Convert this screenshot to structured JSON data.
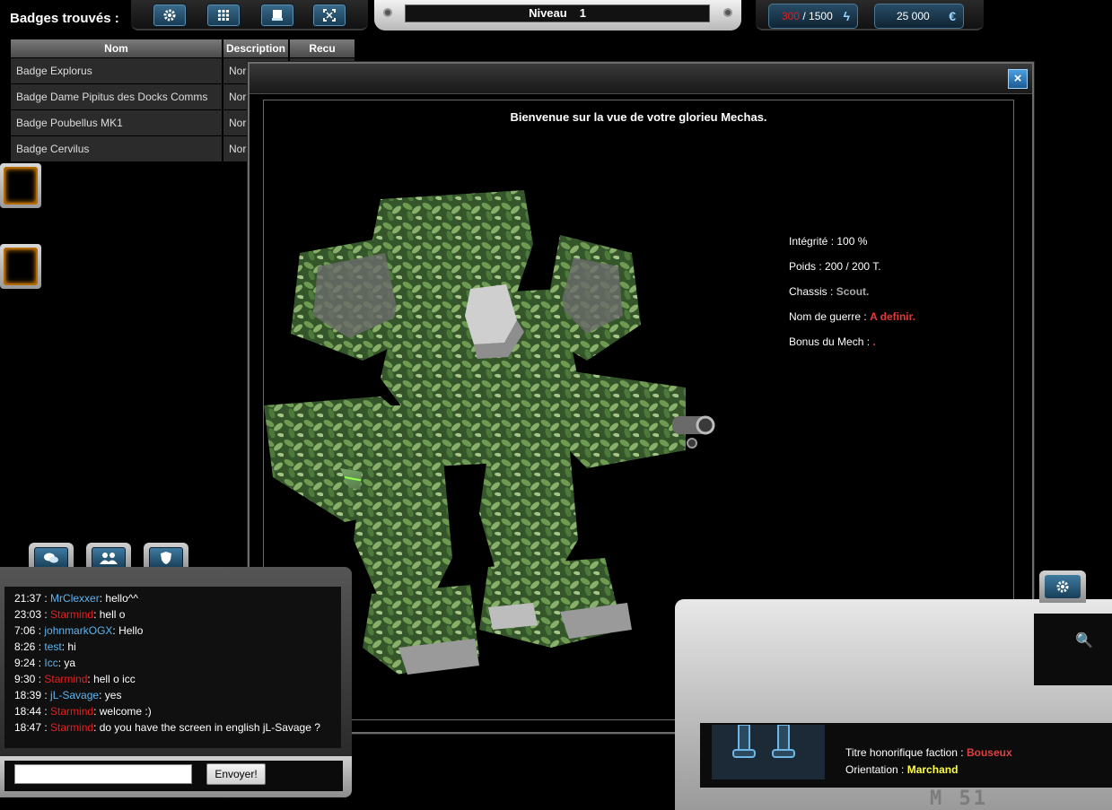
{
  "badges": {
    "title": "Badges trouvés :",
    "columns": [
      "Nom",
      "Description",
      "Recu"
    ],
    "rows": [
      {
        "nom": "Badge Explorus",
        "description": "Nor"
      },
      {
        "nom": "Badge Dame Pipitus des Docks Comms",
        "description": "Nor"
      },
      {
        "nom": "Badge Poubellus MK1",
        "description": "Nor"
      },
      {
        "nom": "Badge Cervilus",
        "description": "Nor"
      }
    ]
  },
  "toolbar": {
    "buttons": [
      "gear-icon",
      "grid-icon",
      "drive-icon",
      "fullscreen-icon"
    ]
  },
  "level": {
    "label": "Niveau",
    "value": "1"
  },
  "energy": {
    "current": "300",
    "max": "/ 1500",
    "icon": "lightning-icon"
  },
  "money": {
    "amount": "25 000",
    "currency_symbol": "€"
  },
  "modal": {
    "title": "Bienvenue sur la vue de votre glorieu Mechas.",
    "close_label": "×",
    "stats": {
      "integrite_label": "Intégrité :",
      "integrite_value": "100 %",
      "poids_label": "Poids :",
      "poids_value": "200 / 200 T.",
      "chassis_label": "Chassis :",
      "chassis_value": "Scout.",
      "nom_label": "Nom de guerre :",
      "nom_value": "A definir.",
      "bonus_label": "Bonus du Mech :",
      "bonus_value": "."
    }
  },
  "chat": {
    "tabs": [
      "chat-bubble-icon",
      "group-icon",
      "shield-icon"
    ],
    "messages": [
      {
        "time": "21:37",
        "user": "MrClexxer",
        "color": "blue",
        "text": "hello^^"
      },
      {
        "time": "23:03",
        "user": "Starmind",
        "color": "red",
        "text": "hell o"
      },
      {
        "time": "7:06",
        "user": "johnmarkOGX",
        "color": "blue",
        "text": "Hello"
      },
      {
        "time": "8:26",
        "user": "test",
        "color": "blue",
        "text": "hi"
      },
      {
        "time": "9:24",
        "user": "Icc",
        "color": "blue",
        "text": "ya"
      },
      {
        "time": "9:30",
        "user": "Starmind",
        "color": "red",
        "text": "hell o icc"
      },
      {
        "time": "18:39",
        "user": "jL-Savage",
        "color": "blue",
        "text": "yes"
      },
      {
        "time": "18:44",
        "user": "Starmind",
        "color": "red",
        "text": "welcome :)"
      },
      {
        "time": "18:47",
        "user": "Starmind",
        "color": "red",
        "text": "do you have the screen in english jL-Savage ?"
      }
    ],
    "input_value": "",
    "send_label": "Envoyer!"
  },
  "profile": {
    "faction_title_label": "Titre honorifique faction :",
    "faction_title_value": "Bouseux",
    "orientation_label": "Orientation :",
    "orientation_value": "Marchand",
    "plate_text": "M    51"
  },
  "colors": {
    "accent_blue": "#2f6f9a",
    "red": "#e02020",
    "yellow": "#ffff40",
    "user_blue": "#5db4f0"
  }
}
